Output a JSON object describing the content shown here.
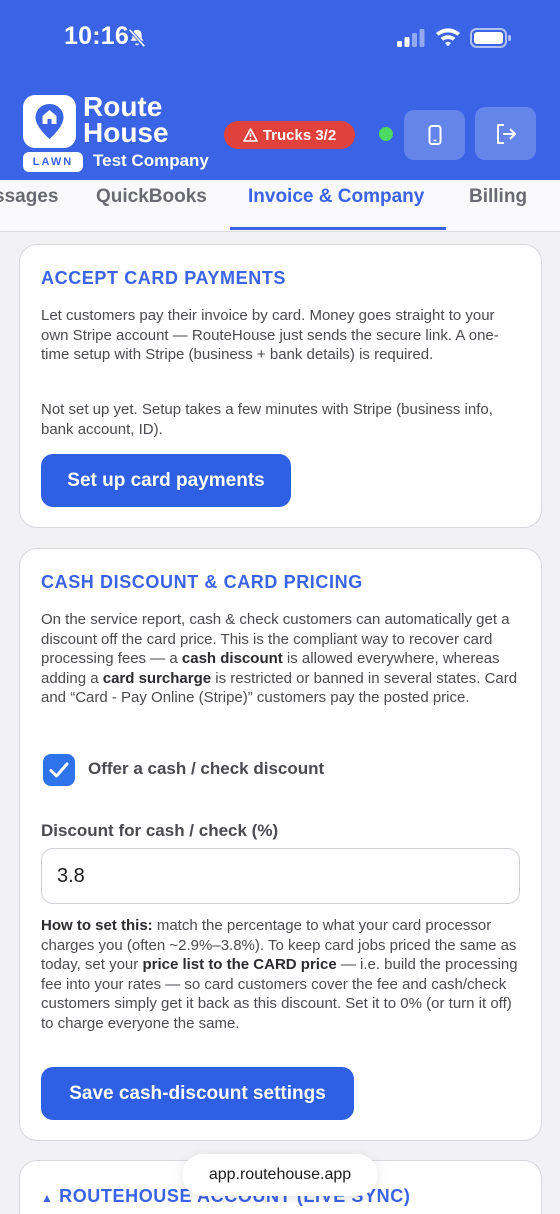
{
  "status_bar": {
    "time": "10:16"
  },
  "header": {
    "brand_line1": "Route",
    "brand_line2": "House",
    "badge": "LAWN",
    "company": "Test Company",
    "trucks_label": "Trucks 3/2",
    "status_color": "#4cd964",
    "accent_color": "#3a63e6"
  },
  "tabs": [
    {
      "label": "ssages"
    },
    {
      "label": "QuickBooks"
    },
    {
      "label": "Invoice & Company",
      "active": true
    },
    {
      "label": "Billing"
    }
  ],
  "card_payments": {
    "title": "ACCEPT CARD PAYMENTS",
    "description": "Let customers pay their invoice by card. Money goes straight to your own Stripe account — RouteHouse just sends the secure link. A one-time setup with Stripe (business + bank details) is required.",
    "status": "Not set up yet. Setup takes a few minutes with Stripe (business info, bank account, ID).",
    "button": "Set up card payments"
  },
  "cash_discount": {
    "title": "CASH DISCOUNT & CARD PRICING",
    "desc_1": "On the service report, cash & check customers can automatically get a discount off the card price. This is the compliant way to recover card processing fees — a ",
    "desc_bold_1": "cash discount",
    "desc_2": " is allowed everywhere, whereas adding a ",
    "desc_bold_2": "card surcharge",
    "desc_3": " is restricted or banned in several states. Card and “Card - Pay Online (Stripe)” customers pay the posted price.",
    "checkbox_label": "Offer a cash / check discount",
    "checkbox_checked": true,
    "field_label": "Discount for cash / check (%)",
    "field_value": "3.8",
    "help_bold_1": "How to set this:",
    "help_1": " match the percentage to what your card processor charges you (often ~2.9%–3.8%). To keep card jobs priced the same as today, set your ",
    "help_bold_2": "price list to the CARD price",
    "help_2": " — i.e. build the processing fee into your rates — so card customers cover the fee and cash/check customers simply get it back as this discount. Set it to 0% (or turn it off) to charge everyone the same.",
    "button": "Save cash-discount settings"
  },
  "account_card": {
    "title": "ROUTEHOUSE ACCOUNT (LIVE SYNC)"
  },
  "browser": {
    "url": "app.routehouse.app"
  }
}
